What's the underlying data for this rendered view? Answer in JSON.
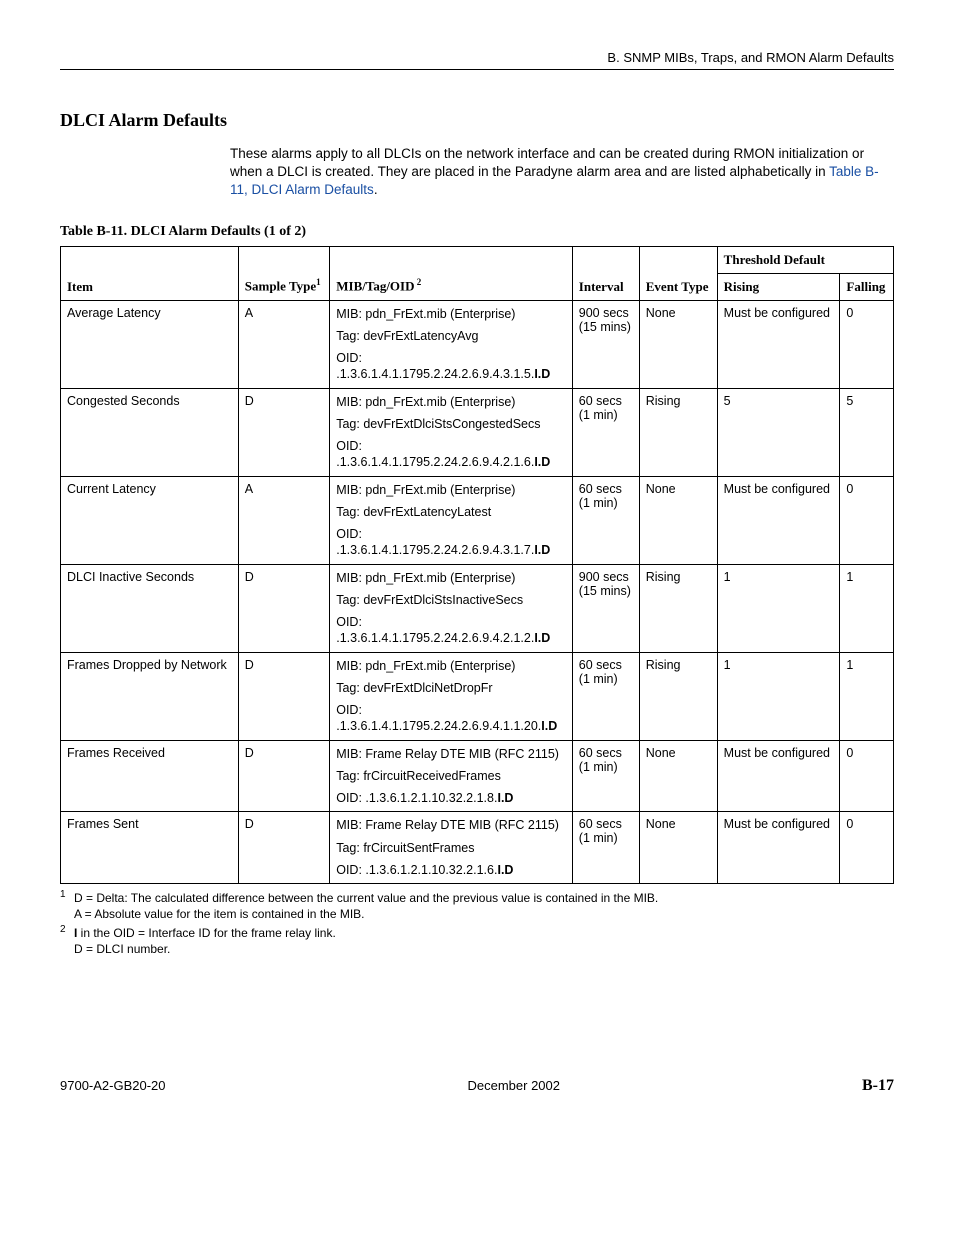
{
  "header": {
    "right": "B. SNMP MIBs, Traps, and RMON Alarm Defaults"
  },
  "section": {
    "title": "DLCI Alarm Defaults",
    "intro_before_link": "These alarms apply to all DLCIs on the network interface and can be created during RMON initialization or when a DLCI is created. They are placed in the Paradyne alarm area and are listed alphabetically in ",
    "intro_link": "Table B-11, DLCI Alarm Defaults",
    "intro_after_link": "."
  },
  "table": {
    "caption": "Table B-11.  DLCI Alarm Defaults (1 of 2)",
    "headers": {
      "item": "Item",
      "sample_type": "Sample Type",
      "sample_type_sup": "1",
      "mib": "MIB/Tag/OID",
      "mib_sup": " 2",
      "interval": "Interval",
      "event_type": "Event Type",
      "threshold": "Threshold Default",
      "rising": "Rising",
      "falling": "Falling"
    },
    "rows": [
      {
        "item": "Average Latency",
        "sample_type": "A",
        "mib": "MIB: pdn_FrExt.mib (Enterprise)",
        "tag": "Tag: devFrExtLatencyAvg",
        "oid_label": "OID:",
        "oid": ".1.3.6.1.4.1.1795.2.24.2.6.9.4.3.1.5.",
        "oid_suffix": "I.D",
        "interval_l1": "900 secs",
        "interval_l2": "(15 mins)",
        "event_type": "None",
        "rising": "Must be configured",
        "falling": "0"
      },
      {
        "item": "Congested Seconds",
        "sample_type": "D",
        "mib": "MIB: pdn_FrExt.mib (Enterprise)",
        "tag": "Tag: devFrExtDlciStsCongestedSecs",
        "oid_label": "OID:",
        "oid": ".1.3.6.1.4.1.1795.2.24.2.6.9.4.2.1.6.",
        "oid_suffix": "I.D",
        "interval_l1": "60 secs",
        "interval_l2": "(1 min)",
        "event_type": "Rising",
        "rising": "5",
        "falling": "5"
      },
      {
        "item": "Current Latency",
        "sample_type": "A",
        "mib": "MIB: pdn_FrExt.mib (Enterprise)",
        "tag": "Tag: devFrExtLatencyLatest",
        "oid_label": "OID:",
        "oid": ".1.3.6.1.4.1.1795.2.24.2.6.9.4.3.1.7.",
        "oid_suffix": "I.D",
        "interval_l1": "60 secs",
        "interval_l2": "(1 min)",
        "event_type": "None",
        "rising": "Must be configured",
        "falling": "0"
      },
      {
        "item": "DLCI Inactive Seconds",
        "sample_type": "D",
        "mib": "MIB: pdn_FrExt.mib (Enterprise)",
        "tag": "Tag: devFrExtDlciStsInactiveSecs",
        "oid_label": "OID:",
        "oid": ".1.3.6.1.4.1.1795.2.24.2.6.9.4.2.1.2.",
        "oid_suffix": "I.D",
        "interval_l1": "900 secs",
        "interval_l2": "(15 mins)",
        "event_type": "Rising",
        "rising": "1",
        "falling": "1"
      },
      {
        "item": "Frames Dropped by Network",
        "sample_type": "D",
        "mib": "MIB: pdn_FrExt.mib (Enterprise)",
        "tag": "Tag: devFrExtDlciNetDropFr",
        "oid_label": "OID:",
        "oid": ".1.3.6.1.4.1.1795.2.24.2.6.9.4.1.1.20.",
        "oid_suffix": "I.D",
        "interval_l1": "60 secs",
        "interval_l2": "(1 min)",
        "event_type": "Rising",
        "rising": "1",
        "falling": "1"
      },
      {
        "item": "Frames Received",
        "sample_type": "D",
        "mib": "MIB: Frame Relay DTE MIB (RFC 2115)",
        "tag": "Tag: frCircuitReceivedFrames",
        "oid_label": "OID: ",
        "oid": ".1.3.6.1.2.1.10.32.2.1.8.",
        "oid_suffix": "I.D",
        "inline_oid": true,
        "interval_l1": "60 secs",
        "interval_l2": "(1 min)",
        "event_type": "None",
        "rising": "Must be configured",
        "falling": "0"
      },
      {
        "item": "Frames Sent",
        "sample_type": "D",
        "mib": "MIB: Frame Relay DTE MIB (RFC 2115)",
        "tag": "Tag: frCircuitSentFrames",
        "oid_label": "OID: ",
        "oid": ".1.3.6.1.2.1.10.32.2.1.6.",
        "oid_suffix": "I.D",
        "inline_oid": true,
        "interval_l1": "60 secs",
        "interval_l2": "(1 min)",
        "event_type": "None",
        "rising": "Must be configured",
        "falling": "0"
      }
    ]
  },
  "footnotes": {
    "f1_num": "1",
    "f1_l1": "D = Delta: The calculated difference between the current value and the previous value is contained in the MIB.",
    "f1_l2": "A = Absolute value for the item is contained in the MIB.",
    "f2_num": "2",
    "f2_l1a": "I",
    "f2_l1b": " in the OID = Interface ID for the frame relay link.",
    "f2_l2": "D = DLCI number."
  },
  "footer": {
    "left": "9700-A2-GB20-20",
    "center": "December 2002",
    "right": "B-17"
  }
}
